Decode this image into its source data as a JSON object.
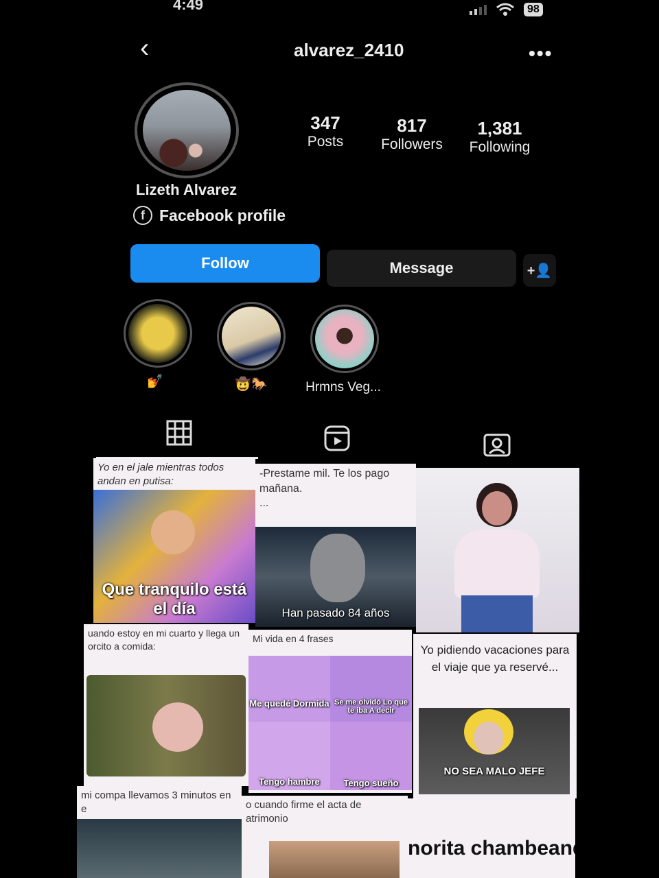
{
  "status_bar": {
    "time": "4:49",
    "battery": "98"
  },
  "header": {
    "back_icon": "‹",
    "username": "alvarez_2410",
    "more_icon": "•••"
  },
  "profile": {
    "full_name": "Lizeth Alvarez",
    "facebook_label": "Facebook profile",
    "stats": [
      {
        "value": "347",
        "label": "Posts"
      },
      {
        "value": "817",
        "label": "Followers"
      },
      {
        "value": "1,381",
        "label": "Following"
      }
    ]
  },
  "actions": {
    "follow": "Follow",
    "message": "Message",
    "add_user_icon": "+👤"
  },
  "highlights": [
    {
      "label": "💅",
      "icon": "nail-polish-emoji"
    },
    {
      "label": "🤠🐎",
      "icon": "cowboy-horse-emoji"
    },
    {
      "label": "Hrmns Veg...",
      "icon": ""
    }
  ],
  "tabs": [
    {
      "name": "grid",
      "icon": "grid-icon"
    },
    {
      "name": "reels",
      "icon": "reels-icon"
    },
    {
      "name": "tagged",
      "icon": "tagged-icon"
    }
  ],
  "posts": [
    {
      "caption": "Yo en el jale mientras todos andan en putisa:",
      "overlay": "Que tranquilo está el día"
    },
    {
      "caption": "-Prestame mil. Te los pago mañana.\n...",
      "overlay": "Han pasado 84 años"
    },
    {
      "caption": "",
      "overlay": ""
    },
    {
      "caption": "uando estoy en mi cuarto y llega un orcito a comida:",
      "overlay": ""
    },
    {
      "caption": "Mi vida en 4 frases",
      "panels": [
        "Me quedé Dormida",
        "Se me olvidó Lo que te iba A decir",
        "Tengo hambre",
        "Tengo sueño"
      ]
    },
    {
      "caption": "Yo pidiendo vacaciones para el viaje que ya reservé...",
      "overlay": "NO SEA MALO JEFE"
    },
    {
      "caption": "mi compa llevamos 3 minutos en e",
      "overlay": ""
    },
    {
      "caption": "o cuando firme el acta de atrimonio",
      "overlay": ""
    },
    {
      "caption": "",
      "overlay": "norita chambeand ro al rato chelean"
    }
  ]
}
